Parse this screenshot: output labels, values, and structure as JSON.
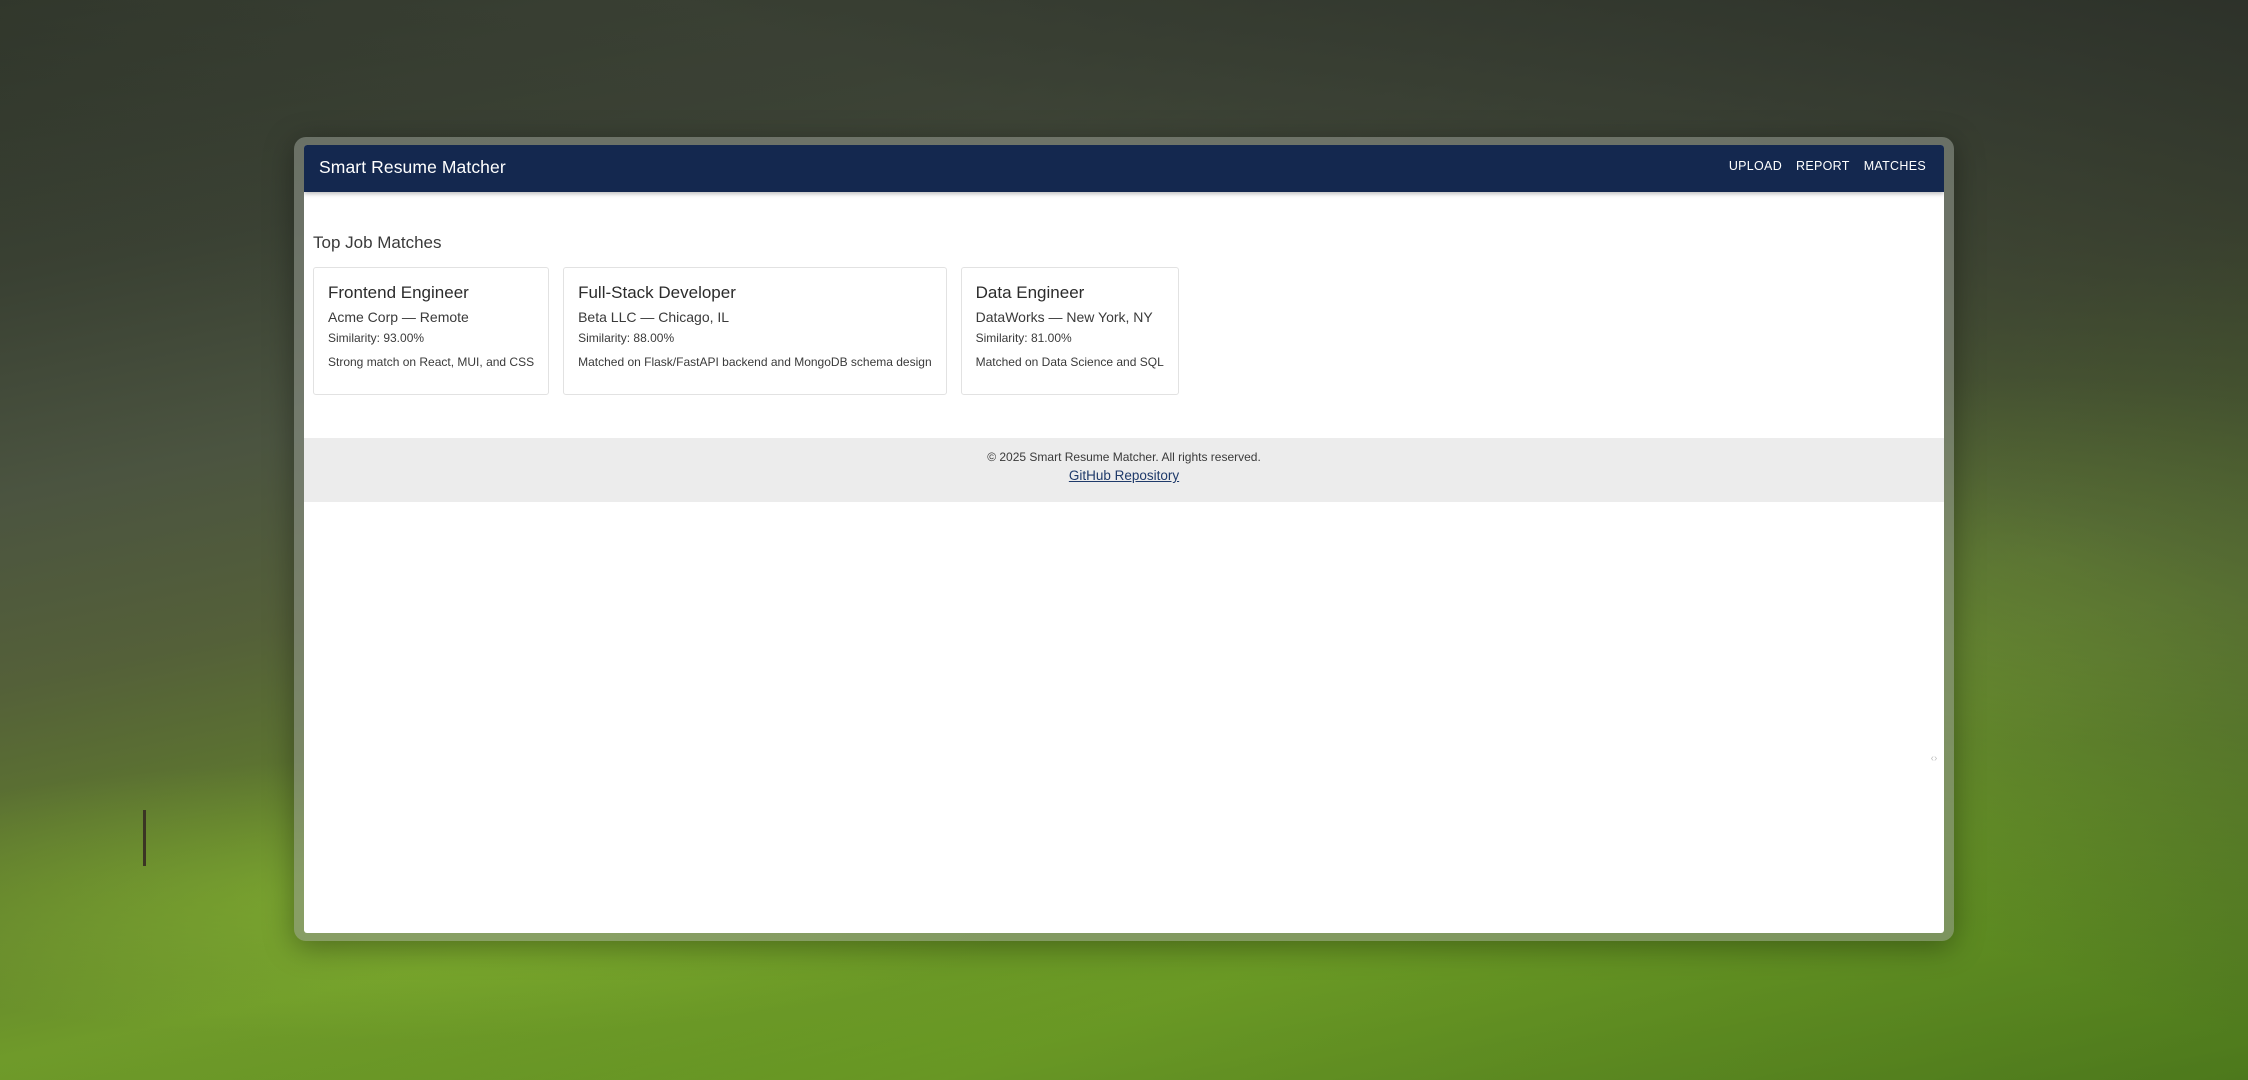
{
  "appbar": {
    "title": "Smart Resume Matcher",
    "nav": [
      "UPLOAD",
      "REPORT",
      "MATCHES"
    ]
  },
  "main": {
    "section_title": "Top Job Matches",
    "cards": [
      {
        "title": "Frontend Engineer",
        "company": "Acme Corp — Remote",
        "similarity": "Similarity: 93.00%",
        "reason": "Strong match on React, MUI, and CSS"
      },
      {
        "title": "Full-Stack Developer",
        "company": "Beta LLC — Chicago, IL",
        "similarity": "Similarity: 88.00%",
        "reason": "Matched on Flask/FastAPI backend and MongoDB schema design"
      },
      {
        "title": "Data Engineer",
        "company": "DataWorks — New York, NY",
        "similarity": "Similarity: 81.00%",
        "reason": "Matched on Data Science and SQL"
      }
    ]
  },
  "footer": {
    "copyright": "© 2025 Smart Resume Matcher. All rights reserved.",
    "link": "GitHub Repository"
  },
  "colors": {
    "appbar": "#14284f",
    "footer_bg": "#ececec",
    "link": "#1f3a6a"
  }
}
